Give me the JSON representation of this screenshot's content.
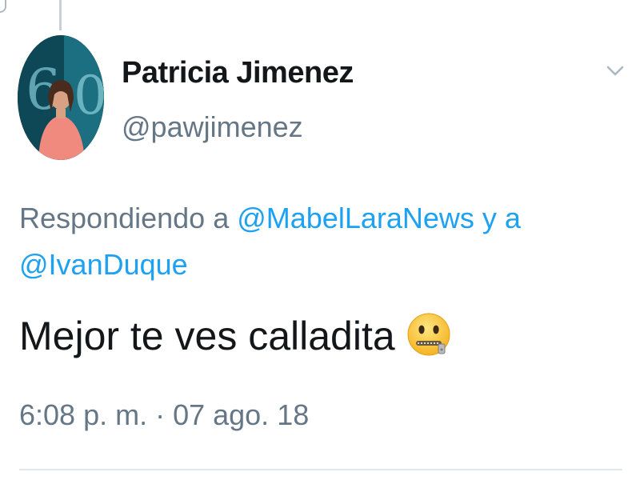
{
  "tweet": {
    "author": {
      "display_name": "Patricia Jimenez",
      "handle": "@pawjimenez",
      "avatar_icon": "profile-photo-avatar"
    },
    "menu_icon": "chevron-down-icon",
    "reply_context": {
      "prefix": "Respondiendo a",
      "mentions": [
        "@MabelLaraNews",
        "@IvanDuque"
      ],
      "connector": "y a"
    },
    "text": "Mejor te ves calladita",
    "emoji_icon": "zipper-mouth-face-icon",
    "timestamp": "6:08 p. m. · 07 ago. 18"
  },
  "colors": {
    "text_primary": "#14171a",
    "text_secondary": "#657786",
    "link": "#1da1f2",
    "divider": "#e1e8ed",
    "thread_line": "#c8d0d6"
  }
}
